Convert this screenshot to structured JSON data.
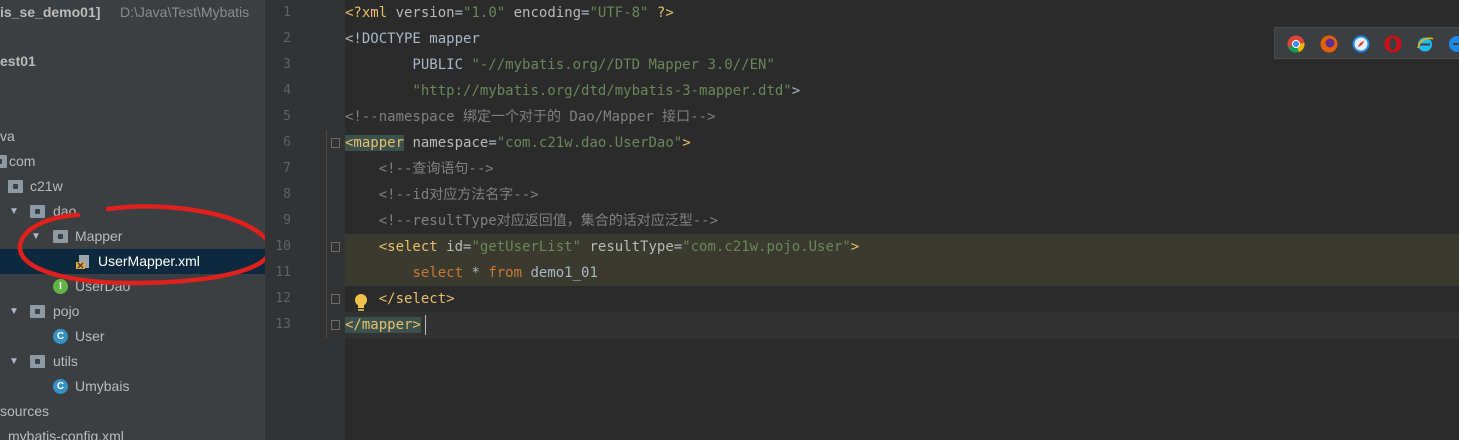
{
  "project_tree": {
    "header_project": "is_se_demo01]",
    "header_path": "D:\\Java\\Test\\Mybatis",
    "module": "est01",
    "items": [
      {
        "label": "va"
      },
      {
        "label": "com"
      },
      {
        "label": "c21w"
      },
      {
        "label": "dao"
      },
      {
        "label": "Mapper"
      },
      {
        "label": "UserMapper.xml",
        "selected": true
      },
      {
        "label": "UserDao"
      },
      {
        "label": "pojo"
      },
      {
        "label": "User"
      },
      {
        "label": "utils"
      },
      {
        "label": "Umybais"
      },
      {
        "label": "sources"
      },
      {
        "label": "mybatis-config.xml"
      }
    ]
  },
  "editor": {
    "line_numbers": [
      "1",
      "2",
      "3",
      "4",
      "5",
      "6",
      "7",
      "8",
      "9",
      "10",
      "11",
      "12",
      "13"
    ],
    "line1": {
      "a": "<?xml ",
      "b": "version",
      "c": "=",
      "d": "\"1.0\"",
      "e": " encoding",
      "f": "=",
      "g": "\"UTF-8\"",
      "h": " ?>"
    },
    "line2": {
      "a": "<!DOCTYPE mapper"
    },
    "line3": {
      "a": "        PUBLIC ",
      "b": "\"-//mybatis.org//DTD Mapper 3.0//EN\""
    },
    "line4": {
      "a": "        ",
      "b": "\"http://mybatis.org/dtd/mybatis-3-mapper.dtd\"",
      "c": ">"
    },
    "line5": {
      "a": "<!--namespace 绑定一个对于的 Dao/Mapper 接口-->"
    },
    "line6": {
      "a": "<mapper",
      "b": " namespace",
      "c": "=",
      "d": "\"com.c21w.dao.UserDao\"",
      "e": ">"
    },
    "line7": {
      "a": "    <!--查询语句-->"
    },
    "line8": {
      "a": "    <!--id对应方法名字-->"
    },
    "line9": {
      "a": "    <!--resultType对应返回值，集合的话对应泛型-->"
    },
    "line10": {
      "a": "    <select",
      "b": " id",
      "c": "=",
      "d": "\"getUserList\"",
      "e": " resultType",
      "f": "=",
      "g": "\"com.c21w.pojo.User\"",
      "h": ">"
    },
    "line11": {
      "a": "        ",
      "b": "select",
      "c": " * ",
      "d": "from",
      "e": " demo1_01"
    },
    "line12": {
      "a": "    ",
      "b": "</select>"
    },
    "line13": {
      "a": "</mapper>"
    }
  },
  "browsers": [
    {
      "name": "chrome-icon",
      "color": "#db4437"
    },
    {
      "name": "firefox-icon",
      "color": "#e66000"
    },
    {
      "name": "safari-icon",
      "color": "#1e88e5"
    },
    {
      "name": "opera-icon",
      "color": "#cc0f16"
    },
    {
      "name": "ie-icon",
      "color": "#1ebbee"
    },
    {
      "name": "edge-icon",
      "color": "#1e88e5"
    }
  ],
  "colors": {
    "tag": "#e8bf6a",
    "string": "#6a8759",
    "comment": "#808080",
    "keyword": "#cc7832",
    "annotation": "#e0201c"
  }
}
